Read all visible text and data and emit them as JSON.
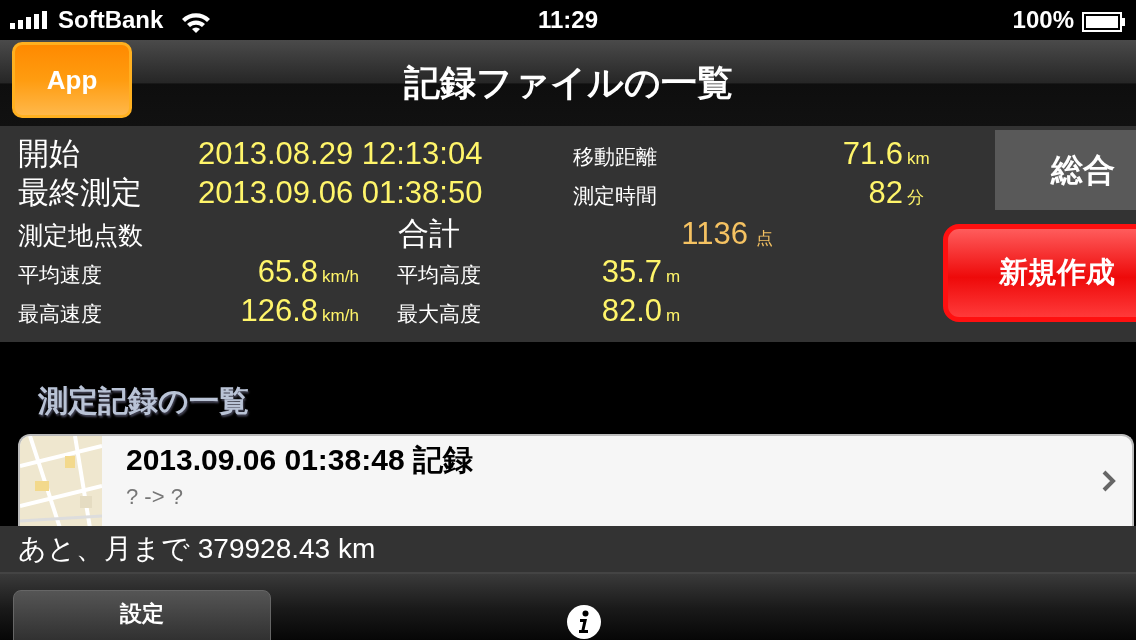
{
  "status_bar": {
    "carrier": "SoftBank",
    "time": "11:29",
    "battery": "100%"
  },
  "nav": {
    "app_button": "App",
    "title": "記録ファイルの一覧"
  },
  "summary": {
    "start": {
      "label": "開始",
      "value": "2013.08.29 12:13:04"
    },
    "last": {
      "label": "最終測定",
      "value": "2013.09.06 01:38:50"
    },
    "distance": {
      "label": "移動距離",
      "value": "71.6",
      "unit": "km"
    },
    "duration": {
      "label": "測定時間",
      "value": "82",
      "unit": "分"
    },
    "points": {
      "label": "測定地点数",
      "total_label": "合計",
      "value": "1136",
      "unit": "点"
    },
    "avg_speed": {
      "label": "平均速度",
      "value": "65.8",
      "unit": "km/h"
    },
    "avg_alt": {
      "label": "平均高度",
      "value": "35.7",
      "unit": "m"
    },
    "max_speed": {
      "label": "最高速度",
      "value": "126.8",
      "unit": "km/h"
    },
    "max_alt": {
      "label": "最大高度",
      "value": "82.0",
      "unit": "m"
    }
  },
  "buttons": {
    "overall": "総合",
    "new": "新規作成"
  },
  "section_title": "測定記録の一覧",
  "records": [
    {
      "title": "2013.09.06 01:38:48 記録",
      "subtitle": "? -> ?"
    }
  ],
  "moon_text": "あと、月まで 379928.43 km",
  "toolbar": {
    "settings": "設定"
  }
}
